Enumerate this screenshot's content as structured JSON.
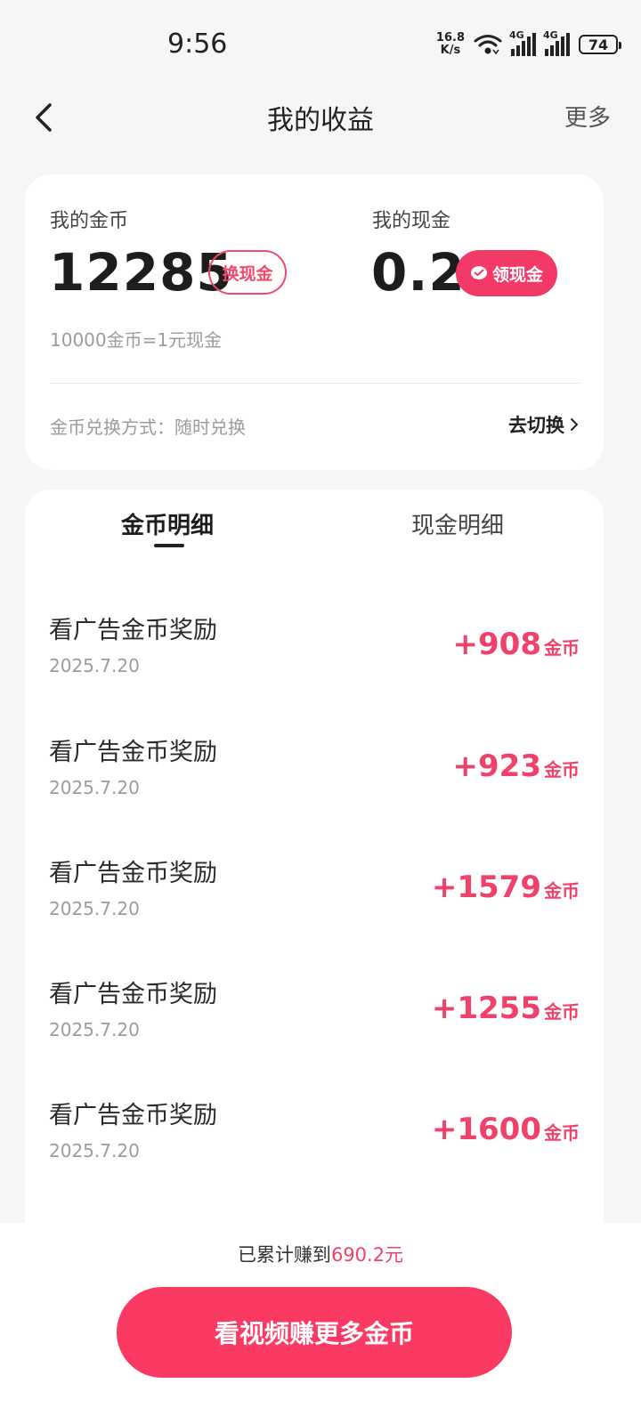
{
  "status_bar": {
    "time": "9:56",
    "net_speed_value": "16.8",
    "net_speed_unit": "K/s",
    "sim1": "4G",
    "sim2": "4G",
    "battery": "74"
  },
  "nav": {
    "title": "我的收益",
    "more": "更多"
  },
  "summary": {
    "coin_label": "我的金币",
    "coin_value": "12285",
    "exchange_button": "换现金",
    "cash_label": "我的现金",
    "cash_value": "0.2",
    "withdraw_button": "领现金",
    "rate_text": "10000金币=1元现金",
    "method_text": "金币兑换方式：随时兑换",
    "switch_link": "去切换"
  },
  "tabs": [
    {
      "label": "金币明细",
      "active": true
    },
    {
      "label": "现金明细",
      "active": false
    }
  ],
  "items": [
    {
      "title": "看广告金币奖励",
      "date": "2025.7.20",
      "amount": "+908",
      "unit": "金币"
    },
    {
      "title": "看广告金币奖励",
      "date": "2025.7.20",
      "amount": "+923",
      "unit": "金币"
    },
    {
      "title": "看广告金币奖励",
      "date": "2025.7.20",
      "amount": "+1579",
      "unit": "金币"
    },
    {
      "title": "看广告金币奖励",
      "date": "2025.7.20",
      "amount": "+1255",
      "unit": "金币"
    },
    {
      "title": "看广告金币奖励",
      "date": "2025.7.20",
      "amount": "+1600",
      "unit": "金币"
    }
  ],
  "bottom": {
    "earned_prefix": "已累计赚到",
    "earned_amount": "690.2元",
    "cta": "看视频赚更多金币"
  },
  "colors": {
    "accent": "#f33a67",
    "amount": "#f0416a",
    "background": "#f6f6f6"
  }
}
